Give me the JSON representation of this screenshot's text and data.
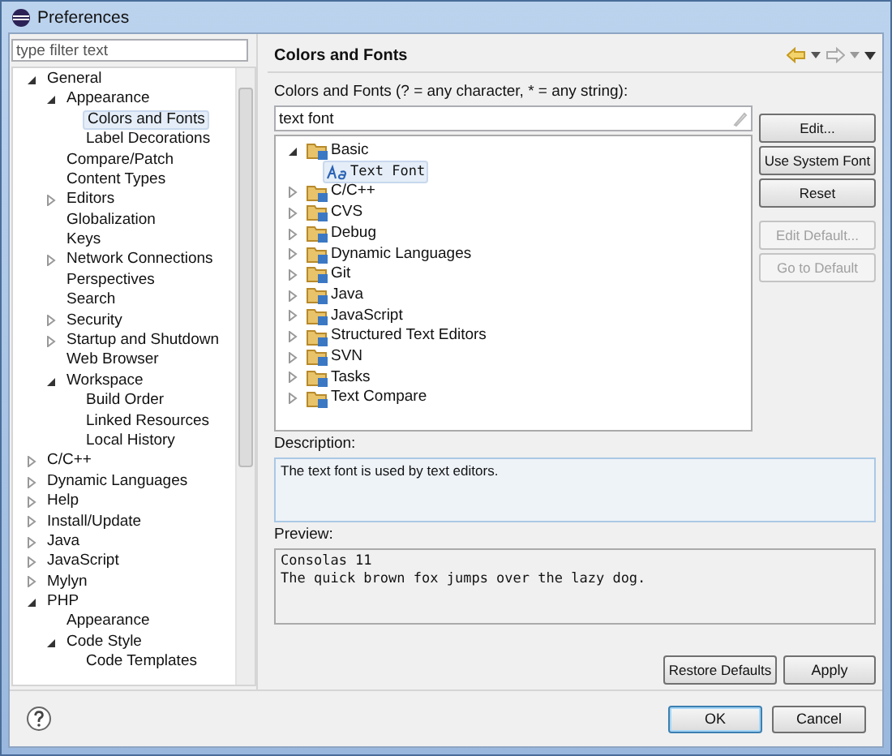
{
  "window": {
    "title": "Preferences"
  },
  "filter": {
    "placeholder": "type filter text"
  },
  "nav_tree": [
    {
      "label": "General",
      "expanded": true,
      "selected": false,
      "children": [
        {
          "label": "Appearance",
          "expanded": true,
          "selected": false,
          "children": [
            {
              "label": "Colors and Fonts",
              "selected": true
            },
            {
              "label": "Label Decorations",
              "selected": false
            }
          ]
        },
        {
          "label": "Compare/Patch",
          "selected": false
        },
        {
          "label": "Content Types",
          "selected": false
        },
        {
          "label": "Editors",
          "expanded": false,
          "selected": false
        },
        {
          "label": "Globalization",
          "selected": false
        },
        {
          "label": "Keys",
          "selected": false
        },
        {
          "label": "Network Connections",
          "expanded": false,
          "selected": false
        },
        {
          "label": "Perspectives",
          "selected": false
        },
        {
          "label": "Search",
          "selected": false
        },
        {
          "label": "Security",
          "expanded": false,
          "selected": false
        },
        {
          "label": "Startup and Shutdown",
          "expanded": false,
          "selected": false
        },
        {
          "label": "Web Browser",
          "selected": false
        },
        {
          "label": "Workspace",
          "expanded": true,
          "selected": false,
          "children": [
            {
              "label": "Build Order",
              "selected": false
            },
            {
              "label": "Linked Resources",
              "selected": false
            },
            {
              "label": "Local History",
              "selected": false
            }
          ]
        }
      ]
    },
    {
      "label": "C/C++",
      "expanded": false,
      "selected": false
    },
    {
      "label": "Dynamic Languages",
      "expanded": false,
      "selected": false
    },
    {
      "label": "Help",
      "expanded": false,
      "selected": false
    },
    {
      "label": "Install/Update",
      "expanded": false,
      "selected": false
    },
    {
      "label": "Java",
      "expanded": false,
      "selected": false
    },
    {
      "label": "JavaScript",
      "expanded": false,
      "selected": false
    },
    {
      "label": "Mylyn",
      "expanded": false,
      "selected": false
    },
    {
      "label": "PHP",
      "expanded": true,
      "selected": false,
      "children": [
        {
          "label": "Appearance",
          "selected": false
        },
        {
          "label": "Code Style",
          "expanded": true,
          "selected": false,
          "children": [
            {
              "label": "Code Templates",
              "selected": false
            }
          ]
        }
      ]
    }
  ],
  "page": {
    "title": "Colors and Fonts",
    "filter_label": "Colors and Fonts (? = any character, * = any string):",
    "filter_value": "text font",
    "tree": [
      {
        "label": "Basic",
        "kind": "category",
        "expanded": true,
        "selected": false,
        "children": [
          {
            "label": "Text Font",
            "kind": "font",
            "selected": true
          }
        ]
      },
      {
        "label": "C/C++",
        "kind": "category",
        "expanded": false,
        "selected": false
      },
      {
        "label": "CVS",
        "kind": "category",
        "expanded": false,
        "selected": false
      },
      {
        "label": "Debug",
        "kind": "category",
        "expanded": false,
        "selected": false
      },
      {
        "label": "Dynamic Languages",
        "kind": "category",
        "expanded": false,
        "selected": false
      },
      {
        "label": "Git",
        "kind": "category",
        "expanded": false,
        "selected": false
      },
      {
        "label": "Java",
        "kind": "category",
        "expanded": false,
        "selected": false
      },
      {
        "label": "JavaScript",
        "kind": "category",
        "expanded": false,
        "selected": false
      },
      {
        "label": "Structured Text Editors",
        "kind": "category",
        "expanded": false,
        "selected": false
      },
      {
        "label": "SVN",
        "kind": "category",
        "expanded": false,
        "selected": false
      },
      {
        "label": "Tasks",
        "kind": "category",
        "expanded": false,
        "selected": false
      },
      {
        "label": "Text Compare",
        "kind": "category",
        "expanded": false,
        "selected": false
      }
    ],
    "buttons": [
      {
        "label": "Edit...",
        "disabled": false
      },
      {
        "label": "Use System Font",
        "disabled": false
      },
      {
        "label": "Reset",
        "disabled": false
      },
      {
        "label": "Edit Default...",
        "disabled": true
      },
      {
        "label": "Go to Default",
        "disabled": true
      }
    ],
    "description_label": "Description:",
    "description": "The text font is used by text editors.",
    "preview_label": "Preview:",
    "preview_lines": [
      "Consolas 11",
      "The quick brown fox jumps over the lazy dog."
    ],
    "page_buttons": [
      "Restore Defaults",
      "Apply"
    ]
  },
  "dialog_buttons": [
    {
      "label": "OK",
      "default": true
    },
    {
      "label": "Cancel",
      "default": false
    }
  ]
}
